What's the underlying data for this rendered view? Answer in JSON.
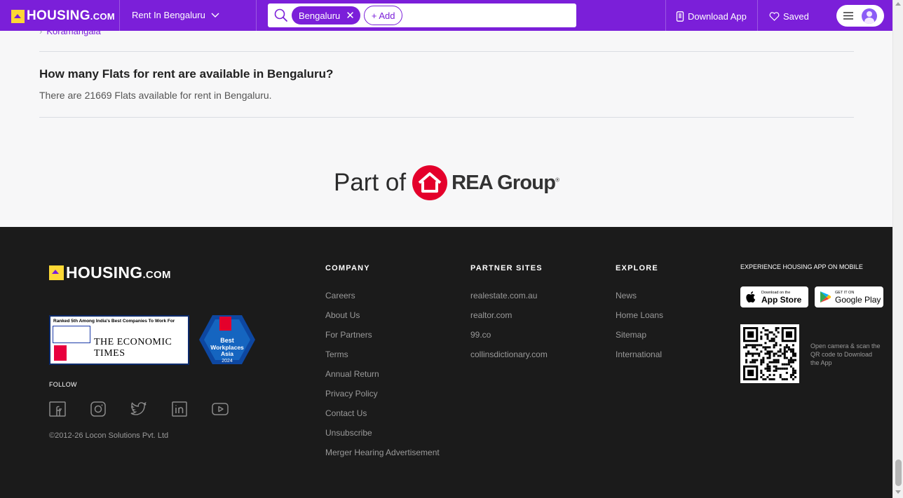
{
  "header": {
    "logo_text": "HOUSING",
    "logo_suffix": ".COM",
    "rent_dropdown": "Rent In Bengaluru",
    "search": {
      "chip": "Bengaluru",
      "add_label": "+ Add",
      "placeholder": ""
    },
    "download_app": "Download App",
    "saved": "Saved",
    "icons": [
      "home-logo-icon",
      "chevron-down-icon",
      "search-icon",
      "close-icon",
      "phone-icon",
      "heart-icon",
      "hamburger-menu-icon",
      "user-avatar-icon"
    ],
    "brand_color": "#7b1fd9"
  },
  "content": {
    "previous_link": "Koramangala",
    "faq": {
      "question": "How many Flats for rent are available in Bengaluru?",
      "answer": "There are 21669 Flats available for rent in Bengaluru."
    },
    "rea": {
      "prefix": "Part of",
      "name": "REA Group",
      "mark": "®",
      "color": "#e4002b"
    }
  },
  "footer": {
    "logo_text": "HOUSING",
    "logo_suffix": ".COM",
    "et_badge": {
      "headline": "Ranked 5th Among India's Best Companies To Work For",
      "brand": "THE ECONOMIC TIMES"
    },
    "asia_badge": {
      "line1": "Best",
      "line2": "Workplaces",
      "line3": "Asia",
      "year": "2024"
    },
    "follow_label": "FOLLOW",
    "socials": [
      "facebook-icon",
      "instagram-icon",
      "twitter-icon",
      "linkedin-icon",
      "youtube-icon"
    ],
    "copyright": "©2012-26 Locon Solutions Pvt. Ltd",
    "columns": [
      {
        "heading": "COMPANY",
        "links": [
          "Careers",
          "About Us",
          "For Partners",
          "Terms",
          "Annual Return",
          "Privacy Policy",
          "Contact Us",
          "Unsubscribe",
          "Merger Hearing Advertisement"
        ]
      },
      {
        "heading": "PARTNER SITES",
        "links": [
          "realestate.com.au",
          "realtor.com",
          "99.co",
          "collinsdictionary.com"
        ]
      },
      {
        "heading": "EXPLORE",
        "links": [
          "News",
          "Home Loans",
          "Sitemap",
          "International"
        ]
      }
    ],
    "app": {
      "heading": "EXPERIENCE HOUSING APP ON MOBILE",
      "app_store_small": "Download on the",
      "app_store": "App Store",
      "play_small": "GET IT ON",
      "play": "Google Play",
      "qr_note": "Open camera & scan the QR code to Download the App"
    }
  }
}
